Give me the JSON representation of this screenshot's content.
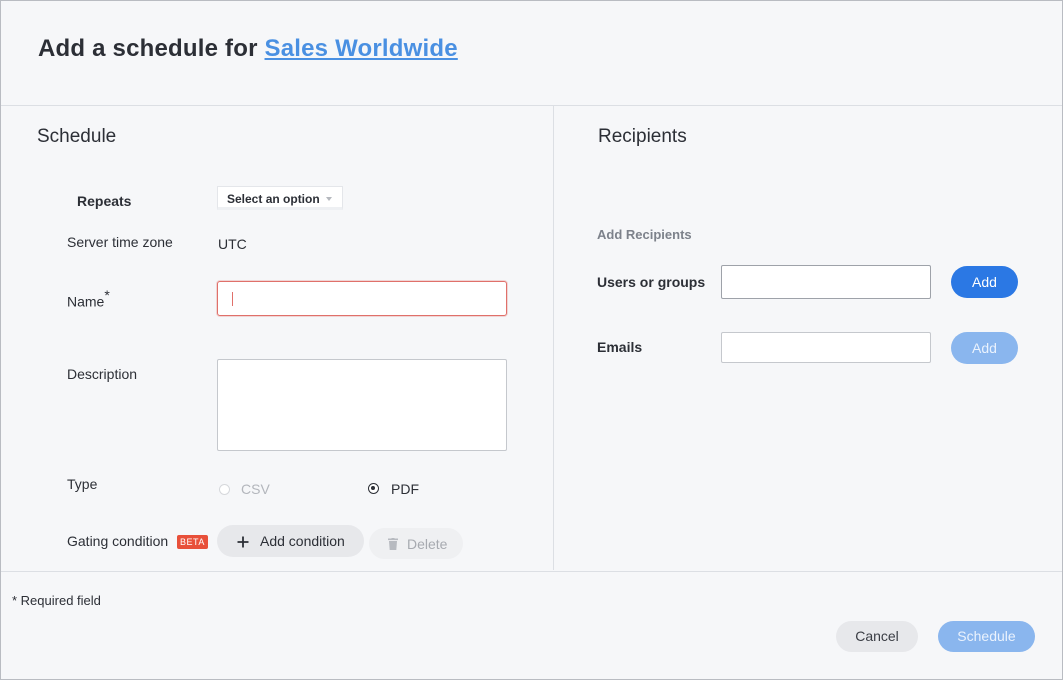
{
  "header": {
    "title_prefix": "Add a schedule for",
    "title_link": "Sales Worldwide"
  },
  "schedule": {
    "section_title": "Schedule",
    "repeats_label": "Repeats",
    "repeats_value": "Select an option",
    "timezone_label": "Server time zone",
    "timezone_value": "UTC",
    "name_label": "Name",
    "name_required_mark": "*",
    "name_value": "",
    "description_label": "Description",
    "description_value": "",
    "type_label": "Type",
    "type_options": [
      {
        "label": "CSV",
        "selected": false,
        "disabled": true
      },
      {
        "label": "PDF",
        "selected": true,
        "disabled": false
      }
    ],
    "gating_label": "Gating condition",
    "gating_badge": "BETA",
    "add_condition_label": "Add condition",
    "delete_label": "Delete"
  },
  "recipients": {
    "section_title": "Recipients",
    "subheading": "Add Recipients",
    "users_label": "Users or groups",
    "users_value": "",
    "users_add": "Add",
    "emails_label": "Emails",
    "emails_value": "",
    "emails_add": "Add"
  },
  "footer": {
    "required_note": "* Required field",
    "cancel_label": "Cancel",
    "schedule_label": "Schedule"
  },
  "colors": {
    "link": "#4a90e2",
    "primary": "#2b78e4",
    "primary_disabled": "#8ab6ee",
    "error": "#e0706a",
    "badge": "#e8503a"
  }
}
